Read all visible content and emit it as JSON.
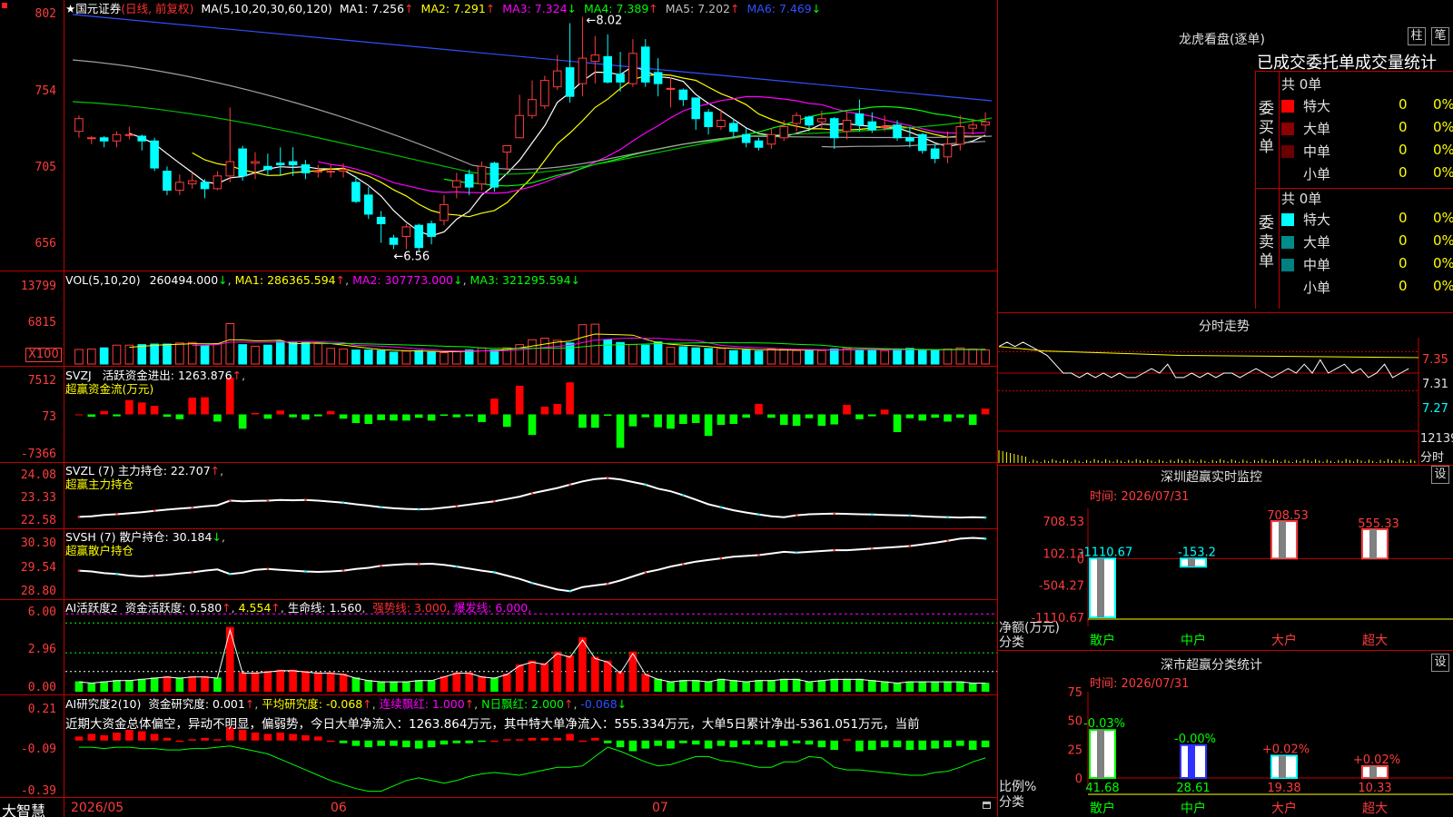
{
  "chart_data": {
    "type": "candlestick",
    "title": "国元证券",
    "subtitle": "(日线, 前复权)",
    "app_name": "大智慧",
    "x_tick_labels": [
      "2026/05",
      "06",
      "07"
    ],
    "price_axis": {
      "ticks": [
        "802",
        "754",
        "705",
        "656"
      ],
      "ylim": [
        646,
        808
      ]
    },
    "price_annotations": {
      "high": "8.02",
      "low": "6.56"
    },
    "ma_header": {
      "label": "MA(5,10,20,30,60,120)",
      "items": [
        "MA1: 7.256",
        "MA2: 7.291",
        "MA3: 7.324",
        "MA4: 7.389",
        "MA5: 7.202",
        "MA6: 7.469"
      ]
    },
    "candles": [
      [
        7.3,
        7.38,
        7.26,
        7.4
      ],
      [
        7.26,
        7.26,
        7.22,
        7.27
      ],
      [
        7.26,
        7.24,
        7.2,
        7.27
      ],
      [
        7.24,
        7.28,
        7.2,
        7.3
      ],
      [
        7.28,
        7.28,
        7.25,
        7.33
      ],
      [
        7.27,
        7.24,
        7.18,
        7.28
      ],
      [
        7.24,
        7.07,
        7.05,
        7.26
      ],
      [
        7.05,
        6.93,
        6.9,
        7.08
      ],
      [
        6.93,
        6.98,
        6.9,
        7.03
      ],
      [
        6.97,
        6.99,
        6.94,
        7.04
      ],
      [
        6.98,
        6.94,
        6.88,
        7.0
      ],
      [
        6.94,
        7.02,
        6.93,
        7.05
      ],
      [
        7.02,
        7.11,
        6.98,
        7.45
      ],
      [
        7.19,
        7.02,
        6.99,
        7.21
      ],
      [
        7.1,
        7.11,
        7.0,
        7.17
      ],
      [
        7.08,
        7.06,
        7.02,
        7.16
      ],
      [
        7.1,
        7.09,
        7.02,
        7.2
      ],
      [
        7.11,
        7.09,
        7.02,
        7.2
      ],
      [
        7.09,
        7.04,
        7.0,
        7.12
      ],
      [
        7.05,
        7.05,
        7.01,
        7.09
      ],
      [
        7.05,
        7.05,
        7.01,
        7.09
      ],
      [
        7.05,
        7.06,
        7.01,
        7.1
      ],
      [
        6.98,
        6.86,
        6.85,
        7.02
      ],
      [
        6.9,
        6.78,
        6.75,
        6.95
      ],
      [
        6.76,
        6.72,
        6.6,
        6.8
      ],
      [
        6.63,
        6.59,
        6.56,
        6.65
      ],
      [
        6.64,
        6.7,
        6.56,
        6.72
      ],
      [
        6.71,
        6.57,
        6.55,
        6.72
      ],
      [
        6.72,
        6.64,
        6.59,
        6.74
      ],
      [
        6.74,
        6.84,
        6.71,
        6.9
      ],
      [
        6.95,
        6.99,
        6.88,
        7.04
      ],
      [
        7.03,
        6.95,
        6.9,
        7.06
      ],
      [
        6.97,
        7.08,
        6.93,
        7.11
      ],
      [
        7.1,
        6.95,
        6.92,
        7.11
      ],
      [
        7.17,
        7.21,
        7.06,
        7.21
      ],
      [
        7.26,
        7.4,
        7.26,
        7.53
      ],
      [
        7.4,
        7.5,
        7.38,
        7.62
      ],
      [
        7.46,
        7.62,
        7.44,
        7.65
      ],
      [
        7.58,
        7.68,
        7.56,
        7.78
      ],
      [
        7.7,
        7.52,
        7.48,
        7.98
      ],
      [
        7.6,
        7.76,
        7.52,
        8.02
      ],
      [
        7.74,
        7.78,
        7.6,
        7.9
      ],
      [
        7.77,
        7.61,
        7.6,
        7.91
      ],
      [
        7.66,
        7.61,
        7.55,
        7.8
      ],
      [
        7.6,
        7.79,
        7.58,
        7.88
      ],
      [
        7.83,
        7.61,
        7.58,
        7.88
      ],
      [
        7.67,
        7.6,
        7.52,
        7.76
      ],
      [
        7.57,
        7.57,
        7.45,
        7.64
      ],
      [
        7.56,
        7.5,
        7.46,
        7.57
      ],
      [
        7.51,
        7.38,
        7.31,
        7.51
      ],
      [
        7.42,
        7.33,
        7.28,
        7.44
      ],
      [
        7.33,
        7.37,
        7.31,
        7.44
      ],
      [
        7.35,
        7.3,
        7.26,
        7.38
      ],
      [
        7.28,
        7.23,
        7.2,
        7.32
      ],
      [
        7.24,
        7.2,
        7.18,
        7.26
      ],
      [
        7.22,
        7.28,
        7.19,
        7.32
      ],
      [
        7.26,
        7.33,
        7.24,
        7.37
      ],
      [
        7.35,
        7.4,
        7.3,
        7.42
      ],
      [
        7.39,
        7.34,
        7.3,
        7.4
      ],
      [
        7.36,
        7.38,
        7.32,
        7.43
      ],
      [
        7.38,
        7.26,
        7.19,
        7.39
      ],
      [
        7.3,
        7.37,
        7.25,
        7.42
      ],
      [
        7.41,
        7.34,
        7.3,
        7.5
      ],
      [
        7.36,
        7.31,
        7.29,
        7.42
      ],
      [
        7.33,
        7.33,
        7.3,
        7.4
      ],
      [
        7.34,
        7.26,
        7.24,
        7.37
      ],
      [
        7.26,
        7.24,
        7.2,
        7.33
      ],
      [
        7.28,
        7.18,
        7.16,
        7.29
      ],
      [
        7.19,
        7.13,
        7.1,
        7.22
      ],
      [
        7.14,
        7.22,
        7.1,
        7.3
      ],
      [
        7.22,
        7.33,
        7.18,
        7.4
      ],
      [
        7.32,
        7.34,
        7.28,
        7.38
      ],
      [
        7.34,
        7.36,
        7.3,
        7.42
      ]
    ],
    "volume": {
      "header": {
        "label": "VOL(5,10,20)",
        "value": "260494.000",
        "items": [
          "MA1: 286365.594",
          "MA2: 307773.000",
          "MA3: 321295.594"
        ]
      },
      "ticks": [
        "13799",
        "6815"
      ],
      "unit_label": "X100",
      "ylim": [
        0,
        15000
      ],
      "values": [
        2700,
        2800,
        3000,
        3500,
        3500,
        3600,
        3700,
        3700,
        3900,
        4000,
        3400,
        3800,
        7500,
        3600,
        3300,
        3500,
        4200,
        4100,
        4000,
        3800,
        2900,
        2800,
        2600,
        2600,
        2500,
        2200,
        2400,
        2500,
        2200,
        2100,
        2300,
        2600,
        3000,
        2600,
        3000,
        3600,
        4500,
        4800,
        4400,
        3900,
        7300,
        7400,
        4500,
        4000,
        3600,
        3500,
        4100,
        3100,
        3200,
        3000,
        2900,
        2900,
        2500,
        2600,
        2400,
        2800,
        2700,
        2500,
        2600,
        2500,
        2800,
        2900,
        2700,
        2600,
        2500,
        2800,
        2900,
        2500,
        2500,
        2800,
        3000,
        2800,
        2600
      ]
    },
    "svzj": {
      "header": {
        "label": "SVZJ",
        "title": "活跃资金进出:",
        "value": "1263.876",
        "name": "超赢资金流(万元)"
      },
      "ticks": [
        "7512",
        "73",
        "-7366"
      ],
      "ylim": [
        -9600,
        9600
      ],
      "values": [
        0,
        -500,
        700,
        -400,
        3000,
        2500,
        1800,
        -500,
        -1000,
        3500,
        3600,
        -1500,
        7700,
        -3000,
        300,
        -900,
        800,
        -600,
        -1100,
        -400,
        700,
        -900,
        -1800,
        -2000,
        -1200,
        -1300,
        -1300,
        -700,
        -1300,
        -300,
        -600,
        -400,
        -1600,
        3300,
        -2600,
        6000,
        -4300,
        1600,
        2200,
        6700,
        -2800,
        -2800,
        -300,
        -7000,
        -2500,
        -600,
        -2700,
        -3000,
        -2000,
        -1800,
        -4500,
        -2200,
        -2000,
        -700,
        2200,
        -700,
        -2200,
        -2400,
        -800,
        -2400,
        -2100,
        2000,
        -1000,
        -400,
        1000,
        -3700,
        -800,
        -1300,
        -700,
        -1500,
        -700,
        -2200,
        1200
      ]
    },
    "svzl": {
      "header": {
        "label": "SVZL",
        "params": "(7)",
        "title": "主力持仓:",
        "value": "22.707",
        "name": "超赢主力持仓"
      },
      "ticks": [
        "24.08",
        "23.33",
        "22.58"
      ],
      "ylim": [
        22.44,
        24.3
      ],
      "values": [
        22.73,
        22.75,
        22.79,
        22.81,
        22.84,
        22.87,
        22.91,
        22.95,
        22.98,
        23.01,
        23.05,
        23.08,
        23.22,
        23.2,
        23.21,
        23.22,
        23.24,
        23.23,
        23.24,
        23.22,
        23.19,
        23.16,
        23.11,
        23.07,
        23.02,
        22.99,
        22.97,
        22.96,
        22.97,
        23.01,
        23.05,
        23.1,
        23.15,
        23.2,
        23.27,
        23.34,
        23.44,
        23.52,
        23.6,
        23.7,
        23.8,
        23.87,
        23.9,
        23.86,
        23.78,
        23.7,
        23.58,
        23.5,
        23.38,
        23.25,
        23.11,
        23.02,
        22.93,
        22.86,
        22.8,
        22.75,
        22.72,
        22.78,
        22.81,
        22.82,
        22.83,
        22.82,
        22.81,
        22.8,
        22.79,
        22.78,
        22.77,
        22.75,
        22.73,
        22.72,
        22.71,
        22.72,
        22.71
      ]
    },
    "svsh": {
      "header": {
        "label": "SVSH",
        "params": "(7)",
        "title": "散户持仓:",
        "value": "30.184",
        "name": "超赢散户持仓"
      },
      "ticks": [
        "30.30",
        "29.54",
        "28.80"
      ],
      "ylim": [
        28.75,
        30.3
      ],
      "values": [
        29.4,
        29.38,
        29.34,
        29.32,
        29.28,
        29.26,
        29.28,
        29.3,
        29.33,
        29.36,
        29.4,
        29.43,
        29.32,
        29.35,
        29.42,
        29.44,
        29.42,
        29.4,
        29.38,
        29.37,
        29.38,
        29.4,
        29.44,
        29.47,
        29.52,
        29.54,
        29.56,
        29.56,
        29.57,
        29.54,
        29.5,
        29.45,
        29.4,
        29.36,
        29.28,
        29.2,
        29.1,
        29.02,
        28.94,
        28.9,
        29.0,
        29.04,
        29.08,
        29.16,
        29.26,
        29.36,
        29.42,
        29.5,
        29.56,
        29.62,
        29.66,
        29.7,
        29.74,
        29.76,
        29.78,
        29.82,
        29.86,
        29.84,
        29.86,
        29.88,
        29.9,
        29.9,
        29.92,
        29.94,
        29.96,
        29.98,
        30.0,
        30.04,
        30.08,
        30.13,
        30.18,
        30.2,
        30.18
      ]
    },
    "ai_active": {
      "header": {
        "label": "AI活跃度2",
        "title": "资金活跃度:",
        "value": "0.580",
        "value2": "4.554",
        "life_label": "生命线:",
        "life_value": "1.560",
        "strong": "强势线: 3.000,",
        "burst": "爆发线: 6.000,"
      },
      "ticks": [
        "6.00",
        "2.96",
        "0.00"
      ],
      "ylim": [
        0,
        6.3
      ],
      "values": [
        0.8,
        0.7,
        0.8,
        0.9,
        0.9,
        1.0,
        1.1,
        1.2,
        1.1,
        1.2,
        1.2,
        1.1,
        5.0,
        1.5,
        1.5,
        1.6,
        1.7,
        1.7,
        1.6,
        1.5,
        1.5,
        1.4,
        1.1,
        0.9,
        0.8,
        0.8,
        0.8,
        0.9,
        0.9,
        1.2,
        1.5,
        1.5,
        1.2,
        1.1,
        1.4,
        2.1,
        2.4,
        2.2,
        3.1,
        2.8,
        4.2,
        2.7,
        2.4,
        1.5,
        3.1,
        1.4,
        1.0,
        0.8,
        0.9,
        0.9,
        0.8,
        1.0,
        0.9,
        0.8,
        0.9,
        0.9,
        1.0,
        1.0,
        0.8,
        0.9,
        1.0,
        1.0,
        1.0,
        0.9,
        0.8,
        0.7,
        0.8,
        0.8,
        0.8,
        0.8,
        0.8,
        0.7,
        0.7
      ]
    },
    "ai_research": {
      "header": {
        "label": "AI研究度2(10)",
        "title": "资金研究度:",
        "value": "0.001",
        "avg": "平均研究度: -0.068",
        "red": "连续飘红: 1.000",
        "n_red": "N日飘红: 2.000",
        "last": "-0.068"
      },
      "summary": "近期大资金总体偏空，异动不明显，偏弱势，今日大单净流入：1263.864万元，其中特大单净流入：555.334万元，大单5日累计净出-5361.051万元，当前",
      "ticks": [
        "0.21",
        "-0.09",
        "-0.39"
      ],
      "ylim": [
        -0.41,
        0.23
      ],
      "values": [
        0.03,
        0.05,
        0.04,
        0.06,
        0.08,
        0.07,
        0.05,
        0.02,
        0.0,
        0.01,
        0.02,
        0.01,
        0.1,
        0.08,
        0.06,
        0.05,
        0.06,
        0.05,
        0.04,
        0.03,
        0.0,
        -0.02,
        -0.04,
        -0.05,
        -0.04,
        -0.04,
        -0.05,
        -0.06,
        -0.05,
        -0.03,
        -0.02,
        -0.02,
        -0.01,
        0.0,
        0.01,
        0.01,
        0.02,
        0.02,
        0.02,
        0.05,
        0.0,
        0.02,
        -0.02,
        -0.05,
        -0.08,
        -0.06,
        -0.04,
        -0.06,
        -0.02,
        -0.03,
        -0.06,
        -0.04,
        -0.05,
        -0.03,
        -0.03,
        -0.05,
        -0.04,
        -0.02,
        -0.03,
        -0.05,
        -0.07,
        0.01,
        -0.08,
        -0.07,
        -0.05,
        -0.05,
        -0.07,
        -0.07,
        -0.06,
        -0.05,
        -0.04,
        -0.07,
        -0.05
      ],
      "line": [
        -0.05,
        -0.05,
        -0.06,
        -0.05,
        -0.05,
        -0.06,
        -0.06,
        -0.07,
        -0.07,
        -0.06,
        -0.06,
        -0.05,
        -0.04,
        -0.06,
        -0.08,
        -0.1,
        -0.14,
        -0.18,
        -0.22,
        -0.26,
        -0.3,
        -0.33,
        -0.36,
        -0.38,
        -0.38,
        -0.34,
        -0.3,
        -0.28,
        -0.3,
        -0.32,
        -0.3,
        -0.27,
        -0.25,
        -0.24,
        -0.25,
        -0.26,
        -0.24,
        -0.22,
        -0.2,
        -0.2,
        -0.19,
        -0.12,
        -0.05,
        -0.08,
        -0.12,
        -0.16,
        -0.19,
        -0.18,
        -0.15,
        -0.12,
        -0.12,
        -0.15,
        -0.16,
        -0.18,
        -0.2,
        -0.2,
        -0.16,
        -0.16,
        -0.12,
        -0.13,
        -0.2,
        -0.22,
        -0.22,
        -0.23,
        -0.24,
        -0.25,
        -0.26,
        -0.26,
        -0.24,
        -0.23,
        -0.2,
        -0.16,
        -0.13
      ]
    }
  },
  "right_panel": {
    "dragon_tiger": {
      "title": "龙虎看盘(逐单)",
      "btn1": "柱",
      "btn2": "笔",
      "subtitle": "已成交委托单成交量统计",
      "buy_label": "委买单",
      "sell_label": "委卖单",
      "buy_total": "共 0单",
      "sell_total": "共 0单",
      "rows": [
        {
          "label": "特大",
          "value": "0",
          "pct": "0%",
          "buy_color": "#ff0000",
          "sell_color": "#00ffff"
        },
        {
          "label": "大单",
          "value": "0",
          "pct": "0%",
          "buy_color": "#8b0000",
          "sell_color": "#008b8b"
        },
        {
          "label": "中单",
          "value": "0",
          "pct": "0%",
          "buy_color": "#6a0000",
          "sell_color": "#008080"
        },
        {
          "label": "小单",
          "value": "0",
          "pct": "0%"
        }
      ]
    },
    "intraday": {
      "title": "分时走势",
      "ticks": [
        "7.35",
        "7.31",
        "7.27"
      ],
      "vol_label": "12139",
      "footer": "分时",
      "ylim": [
        7.23,
        7.39
      ]
    },
    "monitor": {
      "title": "深圳超赢实时监控",
      "btn": "设",
      "time": "时间: 2026/07/31",
      "ticks": [
        "708.53",
        "102.13",
        "0",
        "-504.27",
        "-1110.67"
      ],
      "ylabel": "净额(万元)",
      "xlabel": "分类",
      "categories": [
        "散户",
        "中户",
        "大户",
        "超大"
      ],
      "values": [
        -1110.67,
        -153.2,
        708.53,
        555.33
      ],
      "value_labels": [
        "-1110.67",
        "-153.2",
        "708.53",
        "555.33"
      ],
      "ylim": [
        -1110.67,
        950
      ]
    },
    "classify": {
      "title": "深市超赢分类统计",
      "btn": "设",
      "time": "时间: 2026/07/31",
      "ticks": [
        "75",
        "50",
        "25",
        "0"
      ],
      "ylabel": "比例%",
      "xlabel": "分类",
      "categories": [
        "散户",
        "中户",
        "大户",
        "超大"
      ],
      "values": [
        41.68,
        28.61,
        19.38,
        10.33
      ],
      "value_labels": [
        "41.68",
        "28.61",
        "19.38",
        "10.33"
      ],
      "changes": [
        "-0.03%",
        "-0.00%",
        "+0.02%",
        "+0.02%"
      ],
      "ylim": [
        0,
        75
      ]
    }
  }
}
